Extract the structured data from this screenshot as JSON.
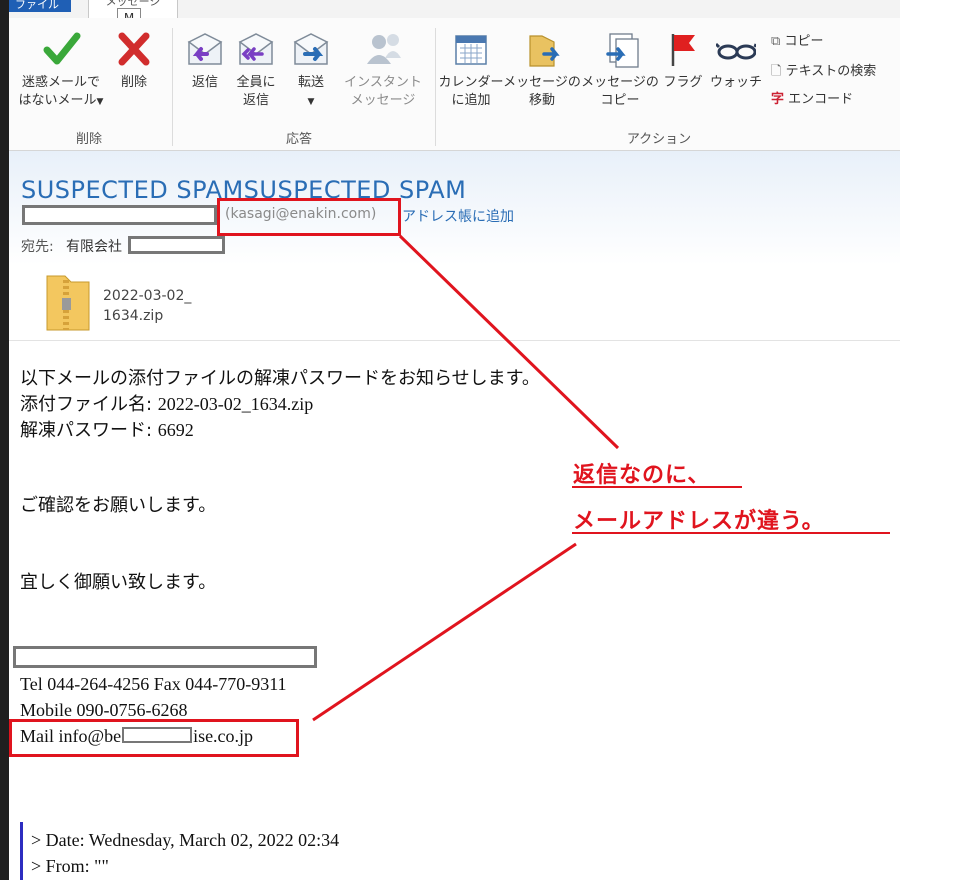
{
  "ribbon": {
    "tabs": {
      "file": "ファイル",
      "message": "メッセージ"
    },
    "keytip": "M",
    "groups": {
      "delete": {
        "label": "削除",
        "not_spam_line1": "迷惑メールで",
        "not_spam_line2": "はないメール",
        "delete": "削除"
      },
      "respond": {
        "label": "応答",
        "reply": "返信",
        "reply_all_line1": "全員に",
        "reply_all_line2": "返信",
        "forward": "転送",
        "im_line1": "インスタント",
        "im_line2": "メッセージ"
      },
      "actions": {
        "label": "アクション",
        "calendar_line1": "カレンダー",
        "calendar_line2": "に追加",
        "move_line1": "メッセージの",
        "move_line2": "移動",
        "copy_line1": "メッセージの",
        "copy_line2": "コピー",
        "flag": "フラグ",
        "watch": "ウォッチ",
        "copy_small": "コピー",
        "find_text": "テキストの検索",
        "encode": "エンコード"
      }
    }
  },
  "header": {
    "subject": "SUSPECTED SPAMSUSPECTED SPAM",
    "sender_email": "(kasagi@enakin.com)",
    "add_contact": "アドレス帳に追加",
    "to_label": "宛先:",
    "to_value": "有限会社",
    "attachment_name_line1": "2022-03-02_",
    "attachment_name_line2": "1634.zip"
  },
  "body": {
    "line1": "以下メールの添付ファイルの解凍パスワードをお知らせします。",
    "line2_label": "添付ファイル名: ",
    "line2_value": "2022-03-02_1634.zip",
    "line3_label": "解凍パスワード: ",
    "line3_value": "6692",
    "line4": "ご確認をお願いします。",
    "line5": "宜しく御願い致します。",
    "tel": "Tel 044-264-4256 Fax 044-770-9311",
    "mobile": "Mobile 090-0756-6268",
    "mail_prefix": "Mail info@be",
    "mail_suffix": "ise.co.jp",
    "quote_date": "> Date: Wednesday, March 02, 2022 02:34",
    "quote_from": "> From: \"\""
  },
  "annotation": {
    "line1": "返信なのに、",
    "line2": "メールアドレスが違う。",
    "color": "#e0141e"
  },
  "colors": {
    "accent": "#2a6db5",
    "file_tab": "#1f5fb5"
  }
}
